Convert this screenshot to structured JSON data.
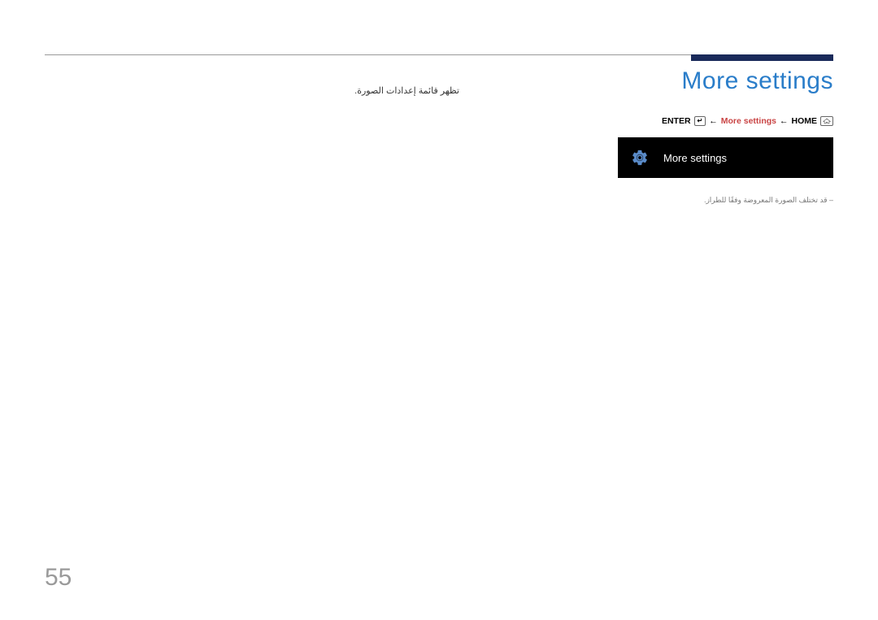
{
  "page": {
    "title": "More settings",
    "description_ar": "تظهر قائمة إعدادات الصورة.",
    "note_ar": "–  قد تختلف الصورة المعروضة وفقًا للطراز.",
    "page_number": "55"
  },
  "breadcrumb": {
    "enter_text": "ENTER",
    "enter_icon_glyph": "↵",
    "arrow": "←",
    "highlight": "More settings",
    "home_text": "HOME"
  },
  "menu": {
    "label": "More settings"
  }
}
